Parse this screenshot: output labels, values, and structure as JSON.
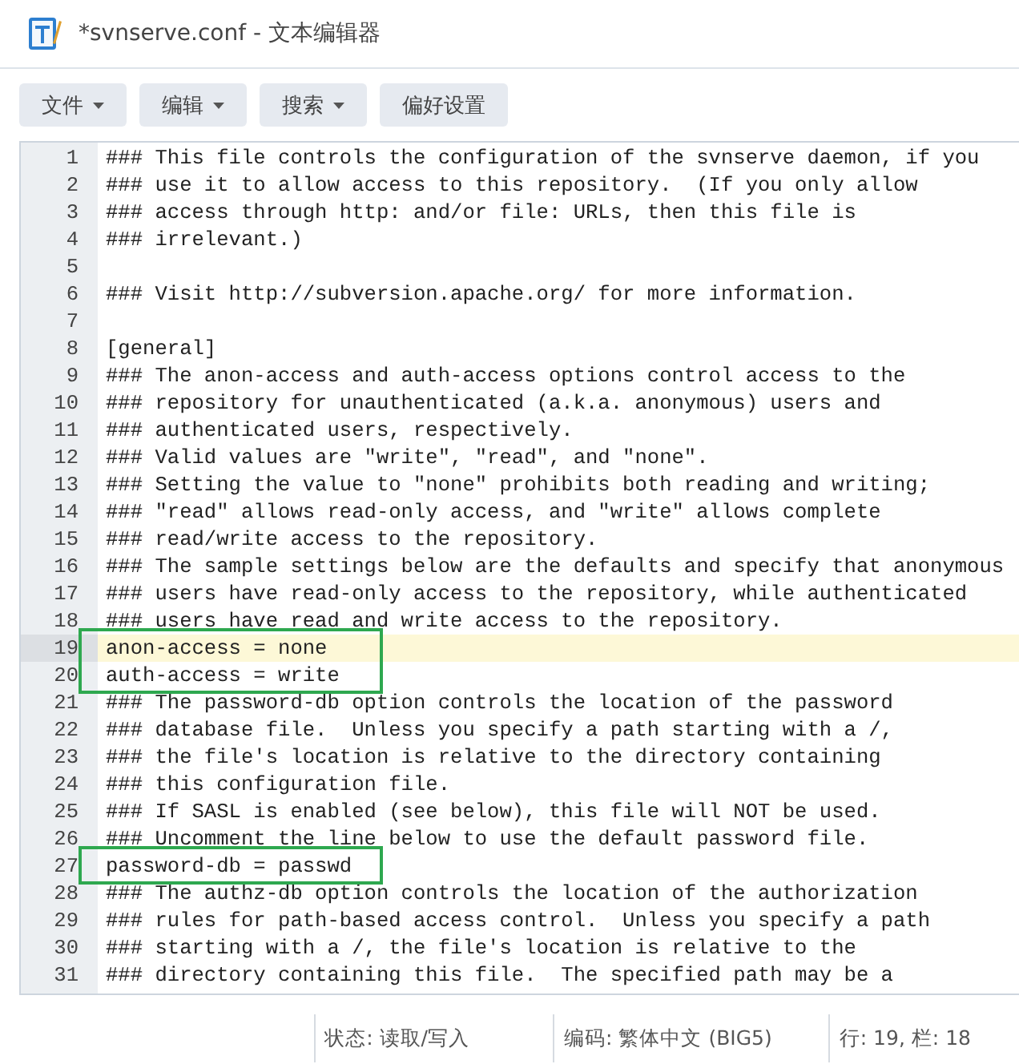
{
  "window": {
    "title": "*svnserve.conf - 文本编辑器"
  },
  "menu": [
    {
      "label": "文件",
      "dropdown": true
    },
    {
      "label": "编辑",
      "dropdown": true
    },
    {
      "label": "搜索",
      "dropdown": true
    },
    {
      "label": "偏好设置",
      "dropdown": false
    }
  ],
  "editor": {
    "lines": [
      {
        "number": "1",
        "text": "### This file controls the configuration of the svnserve daemon, if you",
        "current": false,
        "boxed": false
      },
      {
        "number": "2",
        "text": "### use it to allow access to this repository.  (If you only allow",
        "current": false,
        "boxed": false
      },
      {
        "number": "3",
        "text": "### access through http: and/or file: URLs, then this file is",
        "current": false,
        "boxed": false
      },
      {
        "number": "4",
        "text": "### irrelevant.)",
        "current": false,
        "boxed": false
      },
      {
        "number": "5",
        "current": false,
        "boxed": false
      },
      {
        "number": "6",
        "text": "### Visit http://subversion.apache.org/ for more information.",
        "current": false,
        "boxed": false
      },
      {
        "number": "7",
        "current": false,
        "boxed": false
      },
      {
        "number": "8",
        "text": "[general]",
        "current": false,
        "boxed": false
      },
      {
        "number": "9",
        "text": "### The anon-access and auth-access options control access to the",
        "current": false,
        "boxed": false
      },
      {
        "number": "10",
        "text": "### repository for unauthenticated (a.k.a. anonymous) users and",
        "current": false,
        "boxed": false
      },
      {
        "number": "11",
        "text": "### authenticated users, respectively.",
        "current": false,
        "boxed": false
      },
      {
        "number": "12",
        "text": "### Valid values are \"write\", \"read\", and \"none\".",
        "current": false,
        "boxed": false
      },
      {
        "number": "13",
        "text": "### Setting the value to \"none\" prohibits both reading and writing;",
        "current": false,
        "boxed": false
      },
      {
        "number": "14",
        "text": "### \"read\" allows read-only access, and \"write\" allows complete",
        "current": false,
        "boxed": false
      },
      {
        "number": "15",
        "text": "### read/write access to the repository.",
        "current": false,
        "boxed": false
      },
      {
        "number": "16",
        "text": "### The sample settings below are the defaults and specify that anonymous",
        "current": false,
        "boxed": false
      },
      {
        "number": "17",
        "text": "### users have read-only access to the repository, while authenticated",
        "current": false,
        "boxed": false
      },
      {
        "number": "18",
        "text": "### users have read and write access to the repository.",
        "current": false,
        "boxed": false
      },
      {
        "number": "19",
        "text": "anon-access = none",
        "current": true,
        "boxed": true
      },
      {
        "number": "20",
        "text": "auth-access = write",
        "current": false,
        "boxed": true
      },
      {
        "number": "21",
        "text": "### The password-db option controls the location of the password",
        "current": false,
        "boxed": false
      },
      {
        "number": "22",
        "text": "### database file.  Unless you specify a path starting with a /,",
        "current": false,
        "boxed": false
      },
      {
        "number": "23",
        "text": "### the file's location is relative to the directory containing",
        "current": false,
        "boxed": false
      },
      {
        "number": "24",
        "text": "### this configuration file.",
        "current": false,
        "boxed": false
      },
      {
        "number": "25",
        "text": "### If SASL is enabled (see below), this file will NOT be used.",
        "current": false,
        "boxed": false
      },
      {
        "number": "26",
        "text": "### Uncomment the line below to use the default password file.",
        "current": false,
        "boxed": false
      },
      {
        "number": "27",
        "text": "password-db = passwd",
        "current": false,
        "boxed": true
      },
      {
        "number": "28",
        "text": "### The authz-db option controls the location of the authorization",
        "current": false,
        "boxed": false
      },
      {
        "number": "29",
        "text": "### rules for path-based access control.  Unless you specify a path",
        "current": false,
        "boxed": false
      },
      {
        "number": "30",
        "text": "### starting with a /, the file's location is relative to the",
        "current": false,
        "boxed": false
      },
      {
        "number": "31",
        "text": "### directory containing this file.  The specified path may be a",
        "current": false,
        "boxed": false
      }
    ]
  },
  "status_bar": [
    "状态: 读取/写入",
    "编码: 繁体中文 (BIG5)",
    "行: 19, 栏: 18"
  ]
}
